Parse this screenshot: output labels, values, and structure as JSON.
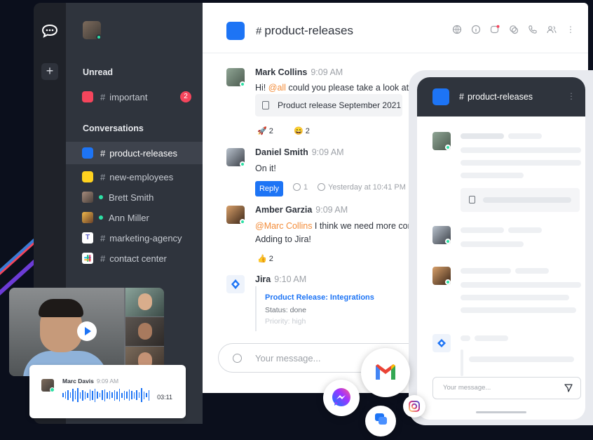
{
  "sidebar": {
    "sections": [
      {
        "title": "Unread",
        "items": [
          {
            "label": "important",
            "badge": "2",
            "color": "#f5455c"
          }
        ]
      },
      {
        "title": "Conversations",
        "items": [
          {
            "label": "product-releases",
            "color": "#1d74f5",
            "active": true
          },
          {
            "label": "new-employees",
            "color": "#ffd21f"
          },
          {
            "label": "Brett Smith",
            "type": "dm"
          },
          {
            "label": "Ann Miller",
            "type": "dm"
          },
          {
            "label": "marketing-agency",
            "icon": "teams-icon"
          },
          {
            "label": "contact center",
            "icon": "slack-icon"
          }
        ]
      }
    ]
  },
  "channel": {
    "title": "product-releases"
  },
  "messages": [
    {
      "author": "Mark Collins",
      "time": "9:09 AM",
      "mention": "@all",
      "text": " could you please take a look at th",
      "attachment": "Product release September 2021",
      "reactions": [
        {
          "emoji": "🚀",
          "count": "2"
        },
        {
          "emoji": "😄",
          "count": "2"
        }
      ]
    },
    {
      "author": "Daniel Smith",
      "time": "9:09 AM",
      "text": "On it!",
      "reply_label": "Reply",
      "thread_count": "1",
      "last_reply": "Yesterday at 10:41 PM"
    },
    {
      "author": "Amber Garzia",
      "time": "9:09 AM",
      "mention": "@Marc Collins",
      "text": " I think we need more con",
      "text2": "Adding to Jira!",
      "reactions": [
        {
          "emoji": "👍",
          "count": "2"
        }
      ]
    },
    {
      "author": "Jira",
      "time": "9:10 AM",
      "card_title": "Product Release: Integrations",
      "card_status": "Status: done",
      "card_priority": "Priority: high"
    }
  ],
  "composer": {
    "placeholder": "Your message..."
  },
  "phone": {
    "title": "product-releases",
    "placeholder": "Your message..."
  },
  "audio": {
    "author": "Marc Davis",
    "time": "9:09 AM",
    "duration": "03:11"
  },
  "colors": {
    "accent": "#1d74f5",
    "sidebar": "#2f343d",
    "badge": "#f5455c",
    "online": "#2de0a5"
  }
}
